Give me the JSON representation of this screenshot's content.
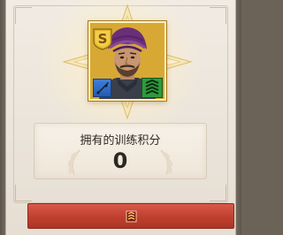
{
  "colors": {
    "button_red": "#c0402f",
    "frame_gold": "#d4a632",
    "badge_weapon_blue": "#2f6cc4",
    "badge_skill_green": "#2e9a3d",
    "text_dark": "#2f2a24"
  },
  "hero": {
    "portrait": "hero-portrait-turban",
    "rank_badge_icon": "s-rank-shield-icon",
    "weapon_icon": "rifle-icon",
    "skill_icon": "training-chevrons-icon"
  },
  "training_points": {
    "label": "拥有的训练积分",
    "value": "0"
  },
  "action_button": {
    "icon": "training-manual-icon"
  }
}
